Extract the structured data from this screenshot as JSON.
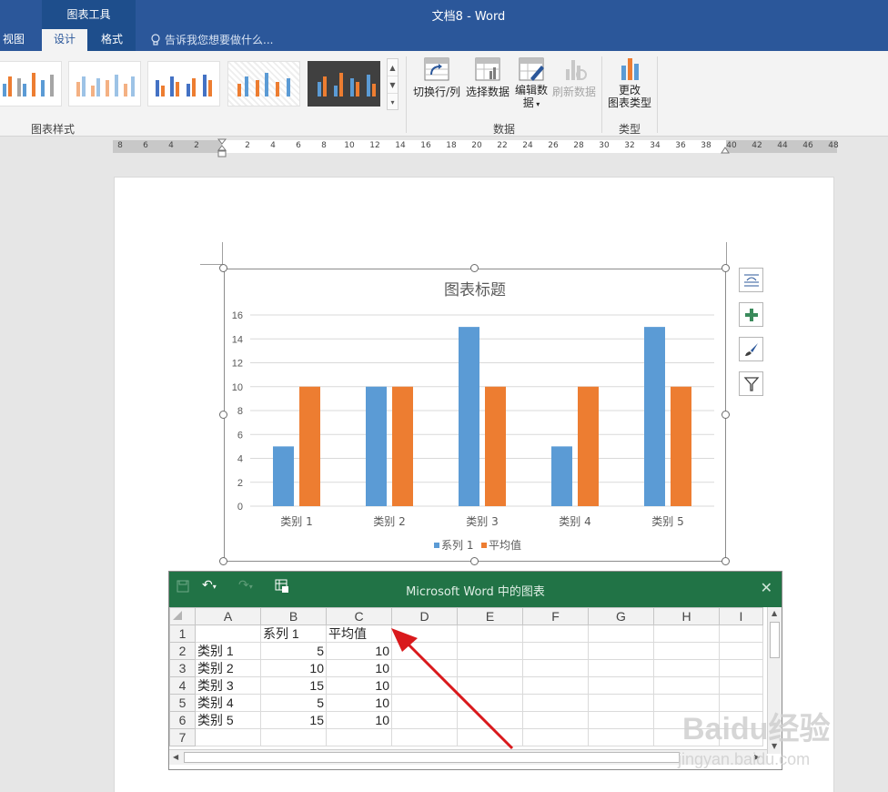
{
  "window": {
    "title": "文档8 - Word",
    "context_tab_group": "图表工具"
  },
  "tabs": [
    {
      "label": "视图",
      "active": false
    },
    {
      "label": "设计",
      "active": true
    },
    {
      "label": "格式",
      "active": false
    }
  ],
  "tell_me": "告诉我您想要做什么...",
  "ribbon": {
    "groups": {
      "chart_styles": "图表样式",
      "data": "数据",
      "type": "类型"
    },
    "buttons": {
      "switch_row_col": "切换行/列",
      "select_data": "选择数据",
      "edit_data_line1": "编辑数",
      "edit_data_line2": "据",
      "refresh_data": "刷新数据",
      "change_type_line1": "更改",
      "change_type_line2": "图表类型"
    }
  },
  "ruler": {
    "left_numbers": [
      "8",
      "6",
      "4",
      "2"
    ],
    "right_numbers": [
      "2",
      "4",
      "6",
      "8",
      "10",
      "12",
      "14",
      "16",
      "18",
      "20",
      "22",
      "24",
      "26",
      "28",
      "30",
      "32",
      "34",
      "36",
      "38",
      "40",
      "42",
      "44",
      "46",
      "48"
    ]
  },
  "colors": {
    "word_blue": "#2b579a",
    "excel_green": "#217346",
    "series1": "#5b9bd5",
    "series2": "#ed7d31",
    "annotation_arrow": "#d9191c"
  },
  "chart_data": {
    "type": "bar",
    "title": "图表标题",
    "categories": [
      "类别 1",
      "类别 2",
      "类别 3",
      "类别 4",
      "类别 5"
    ],
    "series": [
      {
        "name": "系列 1",
        "values": [
          5,
          10,
          15,
          5,
          15
        ],
        "color": "#5b9bd5"
      },
      {
        "name": "平均值",
        "values": [
          10,
          10,
          10,
          10,
          10
        ],
        "color": "#ed7d31"
      }
    ],
    "ylim": [
      0,
      16
    ],
    "yticks": [
      0,
      2,
      4,
      6,
      8,
      10,
      12,
      14,
      16
    ],
    "grid": true,
    "legend": "bottom"
  },
  "excel": {
    "title": "Microsoft Word 中的图表",
    "close_glyph": "✕",
    "columns": [
      "A",
      "B",
      "C",
      "D",
      "E",
      "F",
      "G",
      "H",
      "I"
    ],
    "rows": [
      [
        "",
        "系列 1",
        "平均值",
        "",
        "",
        "",
        "",
        "",
        ""
      ],
      [
        "类别 1",
        "5",
        "10",
        "",
        "",
        "",
        "",
        "",
        ""
      ],
      [
        "类别 2",
        "10",
        "10",
        "",
        "",
        "",
        "",
        "",
        ""
      ],
      [
        "类别 3",
        "15",
        "10",
        "",
        "",
        "",
        "",
        "",
        ""
      ],
      [
        "类别 4",
        "5",
        "10",
        "",
        "",
        "",
        "",
        "",
        ""
      ],
      [
        "类别 5",
        "15",
        "10",
        "",
        "",
        "",
        "",
        "",
        ""
      ],
      [
        "",
        "",
        "",
        "",
        "",
        "",
        "",
        "",
        ""
      ]
    ],
    "row_numbers": [
      "1",
      "2",
      "3",
      "4",
      "5",
      "6",
      "7"
    ]
  },
  "watermark": {
    "brand": "Baidu经验",
    "url": "jingyan.baidu.com"
  }
}
